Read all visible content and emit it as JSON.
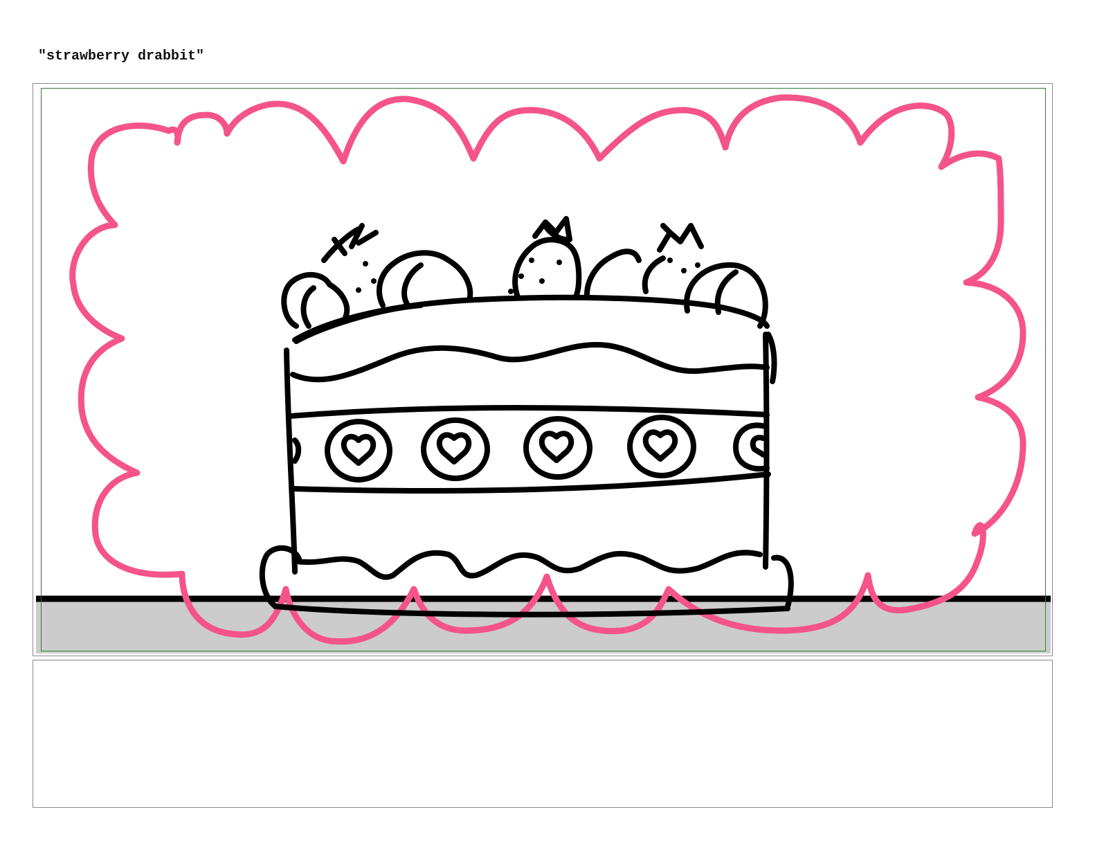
{
  "page": {
    "title": "\"strawberry drabbit\""
  },
  "panel": {
    "safe_frame_color": "#2e7d32",
    "cloud_color": "#f4548a",
    "ink_color": "#000000",
    "floor_color": "#cccccc"
  },
  "notes": {
    "text": ""
  }
}
